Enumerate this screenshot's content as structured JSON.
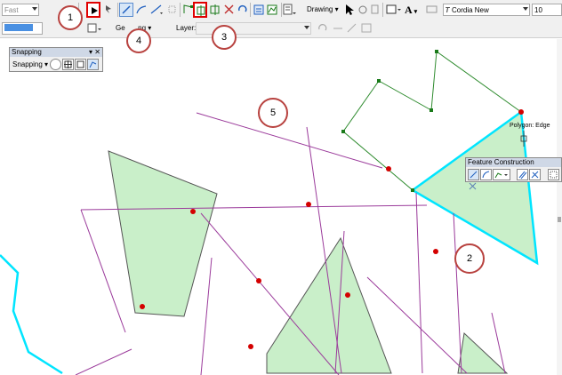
{
  "toolbar1": {
    "speed_value": "Fast",
    "drawing_label": "Drawing",
    "font_name_value": "Cordia New",
    "font_size_value": "10",
    "font_text_button": "A"
  },
  "toolbar2": {
    "georef_label": "Ge",
    "georef_label_tail": "ng",
    "layer_label": "Layer:"
  },
  "snapping": {
    "title": "Snapping",
    "menu_label": "Snapping"
  },
  "feature_construction": {
    "title": "Feature Construction"
  },
  "map": {
    "snap_tip": "Polygon: Edge"
  },
  "callouts": [
    "1",
    "2",
    "3",
    "4",
    "5"
  ],
  "colors": {
    "callout_ring": "#b8423f",
    "highlight_box": "#e00000",
    "polygon_fill": "#c9efc9",
    "line_purple": "#9b3b9b",
    "selected_cyan": "#00e5ff",
    "vertex_green": "#1a7a1a",
    "point_red": "#d40000"
  }
}
